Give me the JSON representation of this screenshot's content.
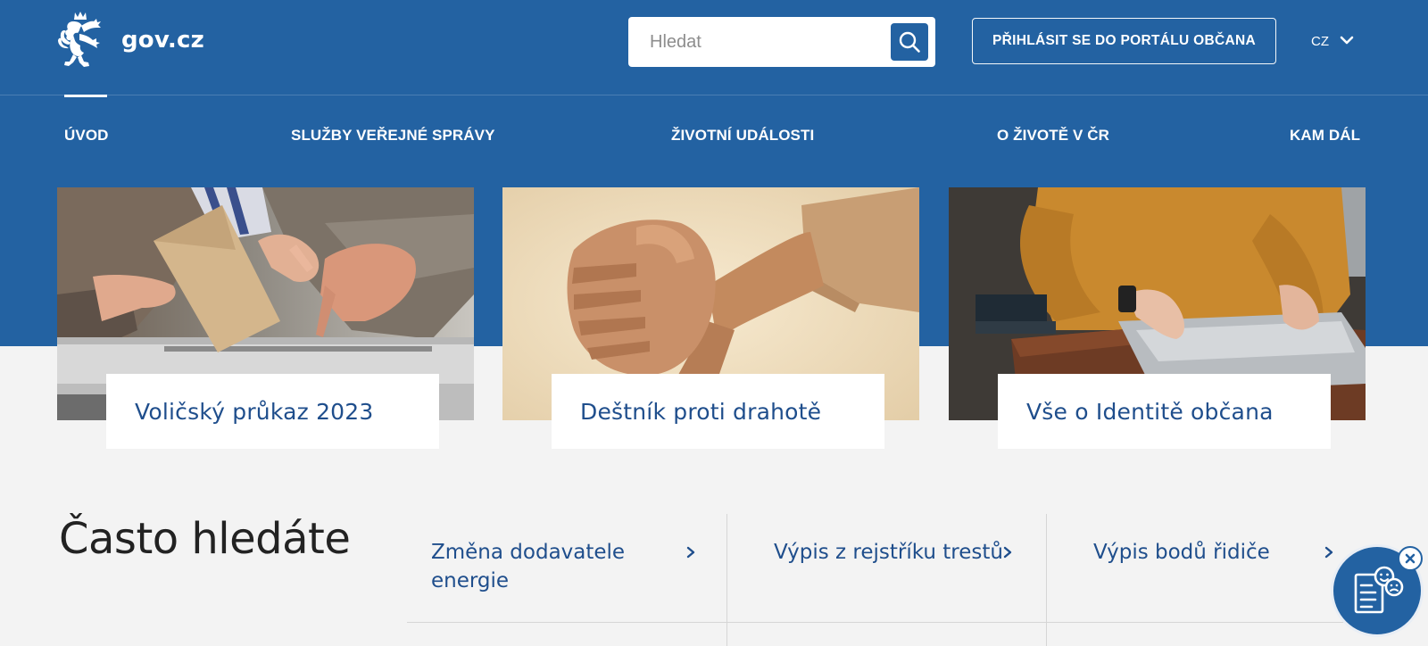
{
  "header": {
    "logo_text": "gov.cz",
    "search_placeholder": "Hledat",
    "login_label": "PŘIHLÁSIT SE DO PORTÁLU OBČANA",
    "language": "CZ"
  },
  "nav": {
    "items": [
      {
        "label": "ÚVOD",
        "active": true
      },
      {
        "label": "SLUŽBY VEŘEJNÉ SPRÁVY",
        "active": false
      },
      {
        "label": "ŽIVOTNÍ UDÁLOSTI",
        "active": false
      },
      {
        "label": "O ŽIVOTĚ V ČR",
        "active": false
      },
      {
        "label": "KAM DÁL",
        "active": false
      }
    ]
  },
  "cards": [
    {
      "title": "Voličský průkaz 2023",
      "image": "hands-voting-ballot-box-photo"
    },
    {
      "title": "Deštník proti drahotě",
      "image": "clasped-hands-photo"
    },
    {
      "title": "Vše o Identitě občana",
      "image": "person-using-laptop-photo"
    }
  ],
  "frequent": {
    "title": "Často hledáte",
    "items": [
      {
        "label": "Změna dodavatele energie"
      },
      {
        "label": "Výpis z rejstříku trestů"
      },
      {
        "label": "Výpis bodů řidiče"
      }
    ]
  },
  "icons": {
    "logo": "czech-lion-coat-of-arms-icon",
    "search": "search-icon",
    "language": "chevron-down-icon",
    "arrow": "chevron-right-icon",
    "feedback": "feedback-form-smileys-icon",
    "close": "close-icon"
  },
  "colors": {
    "brand_blue": "#2362a2",
    "link_blue": "#1f4e8c",
    "page_background": "#f3f3f3",
    "white": "#ffffff"
  }
}
